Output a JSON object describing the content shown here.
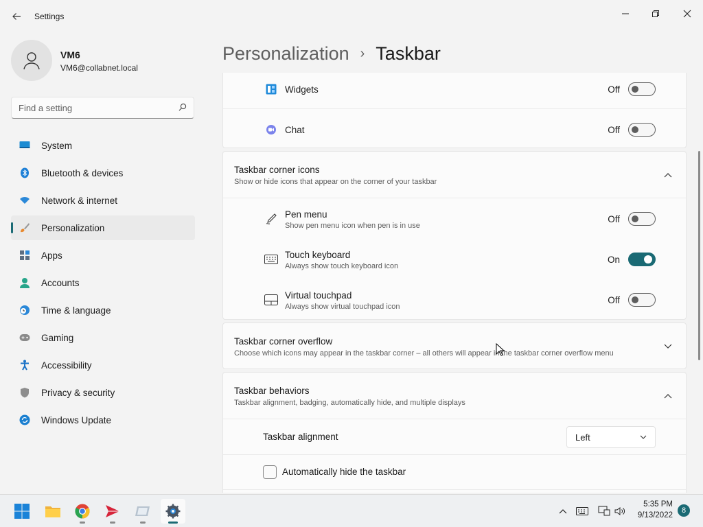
{
  "window": {
    "title": "Settings",
    "controls": {
      "minimize": "—",
      "maximize": "❐",
      "close": "✕"
    }
  },
  "user": {
    "name": "VM6",
    "email": "VM6@collabnet.local"
  },
  "search": {
    "placeholder": "Find a setting",
    "value": ""
  },
  "sidebar": {
    "items": [
      {
        "label": "System",
        "icon": "system-icon"
      },
      {
        "label": "Bluetooth & devices",
        "icon": "bluetooth-icon"
      },
      {
        "label": "Network & internet",
        "icon": "wifi-icon"
      },
      {
        "label": "Personalization",
        "icon": "brush-icon",
        "selected": true
      },
      {
        "label": "Apps",
        "icon": "apps-icon"
      },
      {
        "label": "Accounts",
        "icon": "accounts-icon"
      },
      {
        "label": "Time & language",
        "icon": "clock-globe-icon"
      },
      {
        "label": "Gaming",
        "icon": "gamepad-icon"
      },
      {
        "label": "Accessibility",
        "icon": "accessibility-icon"
      },
      {
        "label": "Privacy & security",
        "icon": "shield-icon"
      },
      {
        "label": "Windows Update",
        "icon": "update-icon"
      }
    ]
  },
  "breadcrumb": {
    "parent": "Personalization",
    "separator": "›",
    "current": "Taskbar"
  },
  "taskbar_items_card": {
    "rows": [
      {
        "label": "Widgets",
        "state": "Off",
        "on": false,
        "icon": "widgets-icon"
      },
      {
        "label": "Chat",
        "state": "Off",
        "on": false,
        "icon": "chat-icon"
      }
    ]
  },
  "corner_icons": {
    "title": "Taskbar corner icons",
    "subtitle": "Show or hide icons that appear on the corner of your taskbar",
    "expanded": true,
    "rows": [
      {
        "label": "Pen menu",
        "description": "Show pen menu icon when pen is in use",
        "state": "Off",
        "on": false,
        "icon": "pen-icon"
      },
      {
        "label": "Touch keyboard",
        "description": "Always show touch keyboard icon",
        "state": "On",
        "on": true,
        "icon": "keyboard-icon"
      },
      {
        "label": "Virtual touchpad",
        "description": "Always show virtual touchpad icon",
        "state": "Off",
        "on": false,
        "icon": "touchpad-icon"
      }
    ]
  },
  "corner_overflow": {
    "title": "Taskbar corner overflow",
    "subtitle": "Choose which icons may appear in the taskbar corner – all others will appear in the taskbar corner overflow menu",
    "expanded": false
  },
  "behaviors": {
    "title": "Taskbar behaviors",
    "subtitle": "Taskbar alignment, badging, automatically hide, and multiple displays",
    "expanded": true,
    "alignment_label": "Taskbar alignment",
    "alignment_value": "Left",
    "autohide_label": "Automatically hide the taskbar",
    "autohide_checked": false
  },
  "taskbar": {
    "apps": [
      "start-icon",
      "file-explorer-icon",
      "chrome-icon",
      "send-app-icon",
      "remote-app-icon",
      "settings-gear-icon"
    ],
    "time": "5:35 PM",
    "date": "9/13/2022",
    "notification_count": "8"
  },
  "colors": {
    "accent": "#1a6a74",
    "background": "#f3f3f3",
    "card": "#fbfbfb"
  }
}
